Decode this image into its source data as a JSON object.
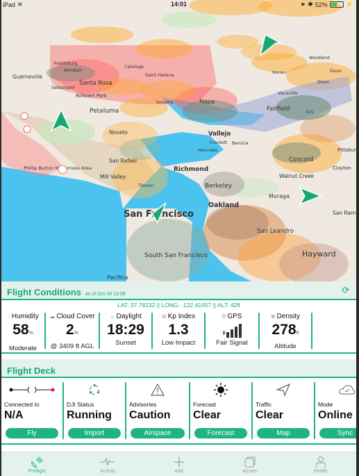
{
  "status_bar": {
    "device": "iPad",
    "time": "14:01",
    "battery_percent": "52%",
    "battery_level": 0.52
  },
  "map": {
    "labels": {
      "guerneville": "Guerneville",
      "healdsburg": "Healdsburg",
      "windsor": "Windsor",
      "santa_rosa": "Santa Rosa",
      "sebastopol": "Sebastopol",
      "rohnert_park": "Rohnert Park",
      "calistoga": "Calistoga",
      "saint_helena": "Saint Helena",
      "sonoma": "Sonoma",
      "petaluma": "Petaluma",
      "novato": "Novato",
      "napa": "Napa",
      "fairfield": "Fairfield",
      "suu": "SUU",
      "vacaville": "Vacaville",
      "woodland": "Woodland",
      "davis": "Davis",
      "dixon": "Dixon",
      "winters": "Winters",
      "vallejo": "Vallejo",
      "crockett": "Crockett",
      "benicia": "Benicia",
      "hercules": "Hercules",
      "richmond": "Richmond",
      "concord": "Concord",
      "clayton": "Clayton",
      "pittsburg": "Pittsburg",
      "walnut_creek": "Walnut Creek",
      "berkeley": "Berkeley",
      "moraga": "Moraga",
      "oakland": "Oakland",
      "san_rafael": "San Rafael",
      "mill_valley": "Mill Valley",
      "tiburon": "Tiburon",
      "san_francisco": "San Francisco",
      "south_sf": "South San Francisco",
      "san_leandro": "San Leandro",
      "hayward": "Hayward",
      "san_ramon": "San Ramon",
      "phillip_burton": "Phillip Burton Wilderness Area",
      "pacifica": "Pacifica"
    }
  },
  "flight_conditions": {
    "title": "Flight Conditions",
    "as_of": "as of Oct-18 13:38",
    "coordinates": "LAT: 37.78232 || LONG: -122.41057 || ALT: 42ft",
    "cards": [
      {
        "label": "Humidity",
        "icon": "droplet-icon",
        "value": "58",
        "unit": "%",
        "sub": "Moderate"
      },
      {
        "label": "Cloud Cover",
        "icon": "cloud-icon",
        "value": "2",
        "unit": "%",
        "sub": "@ 3409 ft AGL"
      },
      {
        "label": "Daylight",
        "icon": "sunset-icon",
        "value": "18:29",
        "unit": "",
        "sub": "Sunset"
      },
      {
        "label": "Kp Index",
        "icon": "magnet-icon",
        "value": "1.3",
        "unit": "",
        "sub": "Low Impact"
      },
      {
        "label": "GPS",
        "icon": "satellite-icon",
        "value": "",
        "unit": "",
        "sub": "Fair Signal",
        "signal_bars": 4
      },
      {
        "label": "Density",
        "icon": "density-icon",
        "value": "278",
        "unit": "ft",
        "sub": "Altitude"
      }
    ]
  },
  "flight_deck": {
    "title": "Flight Deck",
    "cards": [
      {
        "label": "Connected to",
        "value": "N/A",
        "button": "Fly",
        "icon": "connection-icon"
      },
      {
        "label": "DJI Status",
        "value": "Running",
        "button": "Import",
        "icon": "sync-nodes-icon"
      },
      {
        "label": "Advisories",
        "value": "Caution",
        "button": "Airspace",
        "icon": "warning-icon"
      },
      {
        "label": "Forecast",
        "value": "Clear",
        "button": "Forecast",
        "icon": "sun-icon"
      },
      {
        "label": "Traffic",
        "value": "Clear",
        "button": "Map",
        "icon": "navigation-icon"
      },
      {
        "label": "Mode",
        "value": "Online",
        "button": "Sync",
        "icon": "cloud-check-icon"
      }
    ]
  },
  "tab_bar": {
    "tabs": [
      {
        "label": "Preflight",
        "icon": "satellite-dish-icon",
        "active": true
      },
      {
        "label": "Activity",
        "icon": "activity-icon",
        "active": false
      },
      {
        "label": "Add",
        "icon": "plus-icon",
        "active": false
      },
      {
        "label": "Assets",
        "icon": "assets-icon",
        "active": false
      },
      {
        "label": "Profile",
        "icon": "profile-icon",
        "active": false
      }
    ]
  },
  "colors": {
    "accent": "#1fb482",
    "header_bg": "#e3f3ec",
    "map_red_zone": "#ff6b6b",
    "map_orange_zone": "#ffa726",
    "map_blue_zone": "#9aa8d8",
    "water": "#4cc3ee"
  }
}
